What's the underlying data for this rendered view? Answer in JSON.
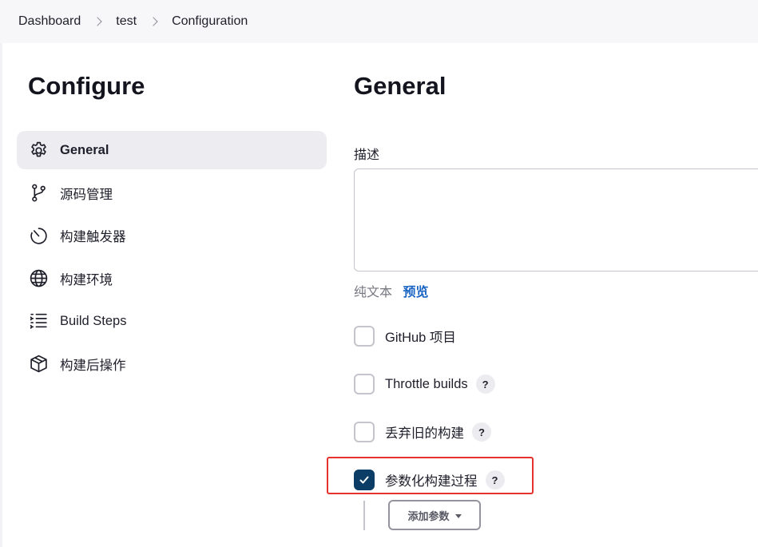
{
  "breadcrumb": {
    "items": [
      "Dashboard",
      "test",
      "Configuration"
    ]
  },
  "sidebar": {
    "title": "Configure",
    "items": [
      {
        "label": "General",
        "icon": "gear-icon",
        "active": true
      },
      {
        "label": "源码管理",
        "icon": "git-branch-icon",
        "active": false
      },
      {
        "label": "构建触发器",
        "icon": "timer-icon",
        "active": false
      },
      {
        "label": "构建环境",
        "icon": "globe-icon",
        "active": false
      },
      {
        "label": "Build Steps",
        "icon": "list-steps-icon",
        "active": false
      },
      {
        "label": "构建后操作",
        "icon": "package-icon",
        "active": false
      }
    ]
  },
  "main": {
    "section_title": "General",
    "description": {
      "label": "描述",
      "value": "",
      "format_plain": "纯文本",
      "preview_label": "预览"
    },
    "options": [
      {
        "label": "GitHub 项目",
        "checked": false,
        "help": ""
      },
      {
        "label": "Throttle builds",
        "checked": false,
        "help": "?"
      },
      {
        "label": "丢弃旧的构建",
        "checked": false,
        "help": "?"
      },
      {
        "label": "参数化构建过程",
        "checked": true,
        "help": "?"
      }
    ],
    "add_parameter_label": "添加参数"
  },
  "colors": {
    "checked": "#0c3d66",
    "highlight": "#e5322d",
    "link": "#1a64c4"
  }
}
